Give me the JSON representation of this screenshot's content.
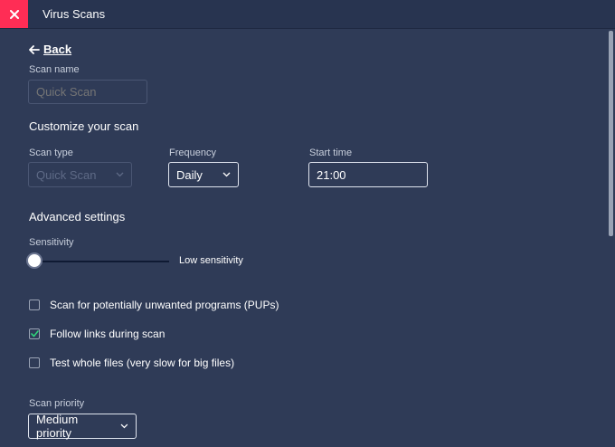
{
  "window": {
    "title": "Virus Scans",
    "accent": "#ff2d55"
  },
  "nav": {
    "back_label": "Back"
  },
  "scan_name": {
    "label": "Scan name",
    "placeholder": "Quick Scan"
  },
  "customize": {
    "heading": "Customize your scan"
  },
  "scan_type": {
    "label": "Scan type",
    "value": "Quick Scan"
  },
  "frequency": {
    "label": "Frequency",
    "value": "Daily"
  },
  "start_time": {
    "label": "Start time",
    "value": "21:00"
  },
  "advanced": {
    "heading": "Advanced settings"
  },
  "sensitivity": {
    "label": "Sensitivity",
    "value_label": "Low sensitivity",
    "level": 0
  },
  "options": [
    {
      "label": "Scan for potentially unwanted programs (PUPs)",
      "checked": false
    },
    {
      "label": "Follow links during scan",
      "checked": true
    },
    {
      "label": "Test whole files (very slow for big files)",
      "checked": false
    }
  ],
  "priority": {
    "label": "Scan priority",
    "value": "Medium priority"
  }
}
